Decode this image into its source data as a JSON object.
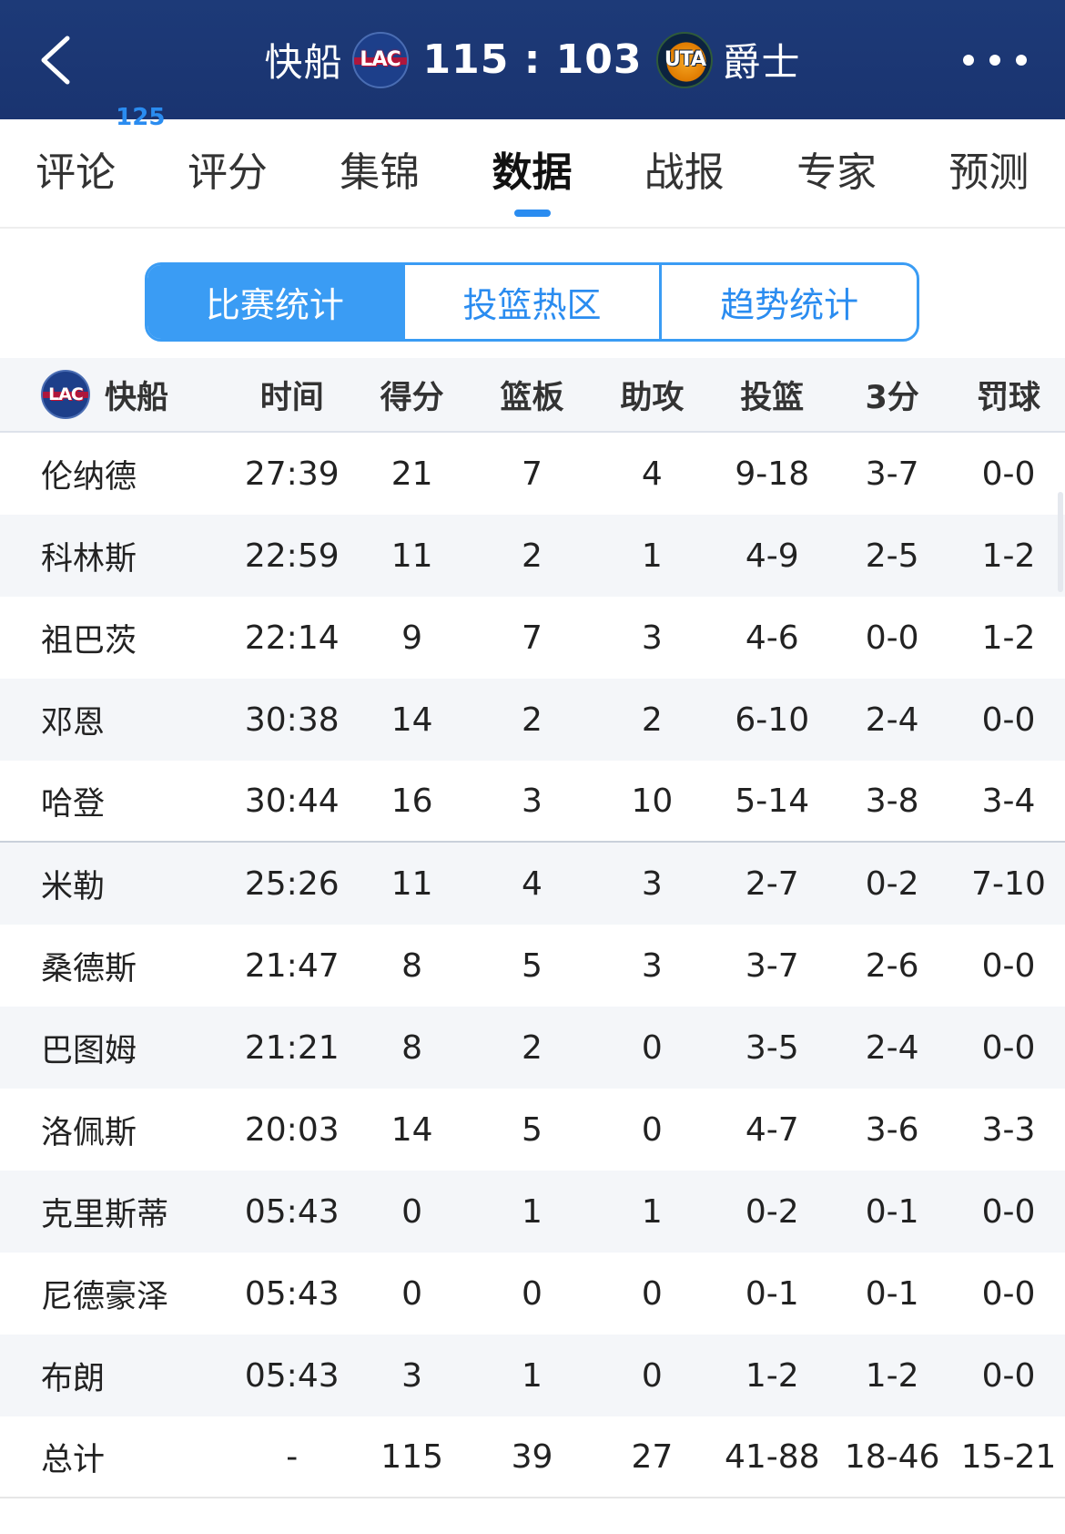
{
  "header": {
    "home_team": "快船",
    "home_logo_text": "LAC",
    "score": "115 : 103",
    "away_team": "爵士",
    "away_logo_text": "UTA"
  },
  "tabs": [
    {
      "label": "评论",
      "badge": "125"
    },
    {
      "label": "评分"
    },
    {
      "label": "集锦"
    },
    {
      "label": "数据",
      "active": true
    },
    {
      "label": "战报"
    },
    {
      "label": "专家"
    },
    {
      "label": "预测"
    }
  ],
  "segments": [
    {
      "label": "比赛统计",
      "active": true
    },
    {
      "label": "投篮热区"
    },
    {
      "label": "趋势统计"
    }
  ],
  "table": {
    "team_label": "快船",
    "team_logo_text": "LAC",
    "columns": [
      "时间",
      "得分",
      "篮板",
      "助攻",
      "投篮",
      "3分",
      "罚球"
    ],
    "rows": [
      [
        "伦纳德",
        "27:39",
        "21",
        "7",
        "4",
        "9-18",
        "3-7",
        "0-0"
      ],
      [
        "科林斯",
        "22:59",
        "11",
        "2",
        "1",
        "4-9",
        "2-5",
        "1-2"
      ],
      [
        "祖巴茨",
        "22:14",
        "9",
        "7",
        "3",
        "4-6",
        "0-0",
        "1-2"
      ],
      [
        "邓恩",
        "30:38",
        "14",
        "2",
        "2",
        "6-10",
        "2-4",
        "0-0"
      ],
      [
        "哈登",
        "30:44",
        "16",
        "3",
        "10",
        "5-14",
        "3-8",
        "3-4"
      ],
      [
        "米勒",
        "25:26",
        "11",
        "4",
        "3",
        "2-7",
        "0-2",
        "7-10"
      ],
      [
        "桑德斯",
        "21:47",
        "8",
        "5",
        "3",
        "3-7",
        "2-6",
        "0-0"
      ],
      [
        "巴图姆",
        "21:21",
        "8",
        "2",
        "0",
        "3-5",
        "2-4",
        "0-0"
      ],
      [
        "洛佩斯",
        "20:03",
        "14",
        "5",
        "0",
        "4-7",
        "3-6",
        "3-3"
      ],
      [
        "克里斯蒂",
        "05:43",
        "0",
        "1",
        "1",
        "0-2",
        "0-1",
        "0-0"
      ],
      [
        "尼德豪泽",
        "05:43",
        "0",
        "0",
        "0",
        "0-1",
        "0-1",
        "0-0"
      ],
      [
        "布朗",
        "05:43",
        "3",
        "1",
        "0",
        "1-2",
        "1-2",
        "0-0"
      ]
    ],
    "total": [
      "总计",
      "-",
      "115",
      "39",
      "27",
      "41-88",
      "18-46",
      "15-21"
    ]
  }
}
